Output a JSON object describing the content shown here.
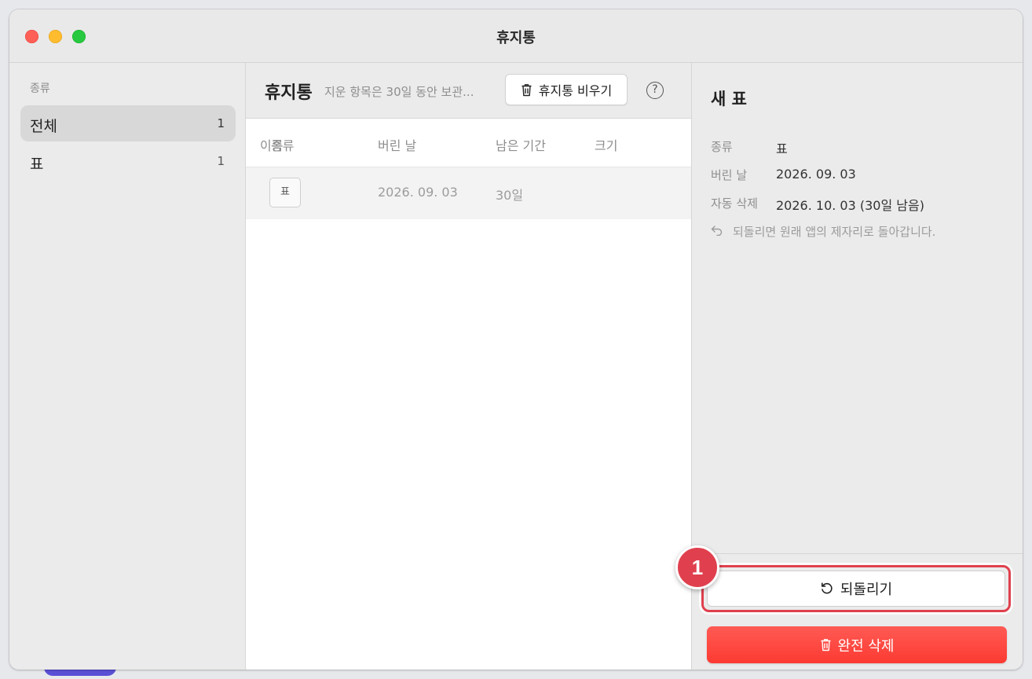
{
  "window": {
    "title": "휴지통"
  },
  "sidebar": {
    "section_label": "종류",
    "items": [
      {
        "label": "전체",
        "count": "1",
        "selected": true
      },
      {
        "label": "표",
        "count": "1",
        "selected": false
      }
    ]
  },
  "list": {
    "title": "휴지통",
    "subtitle": "지운 항목은 30일 동안 보관...",
    "empty_button": "휴지통 비우기",
    "help_icon": "question-circle-icon",
    "columns": {
      "name": "이름",
      "type": "종류",
      "deleted": "버린 날",
      "remaining": "남은 기간",
      "size": "크기"
    },
    "rows": [
      {
        "type_badge": "표",
        "deleted": "2026. 09. 03",
        "remaining": "30일",
        "size": ""
      }
    ]
  },
  "detail": {
    "title": "새 표",
    "type_label": "종류",
    "type_value": "표",
    "deleted_label": "버린 날",
    "deleted_value": "2026. 09. 03",
    "auto_label": "자동 삭제",
    "auto_value": "2026. 10. 03 (30일 남음)",
    "note": "되돌리면 원래 앱의 제자리로 돌아갑니다.",
    "restore_button": "되돌리기",
    "delete_button": "완전 삭제"
  },
  "annotation": {
    "step": "1",
    "color": "#e0404e"
  },
  "colors": {
    "danger": "#fc3b32",
    "selection": "#d8d8d8"
  }
}
